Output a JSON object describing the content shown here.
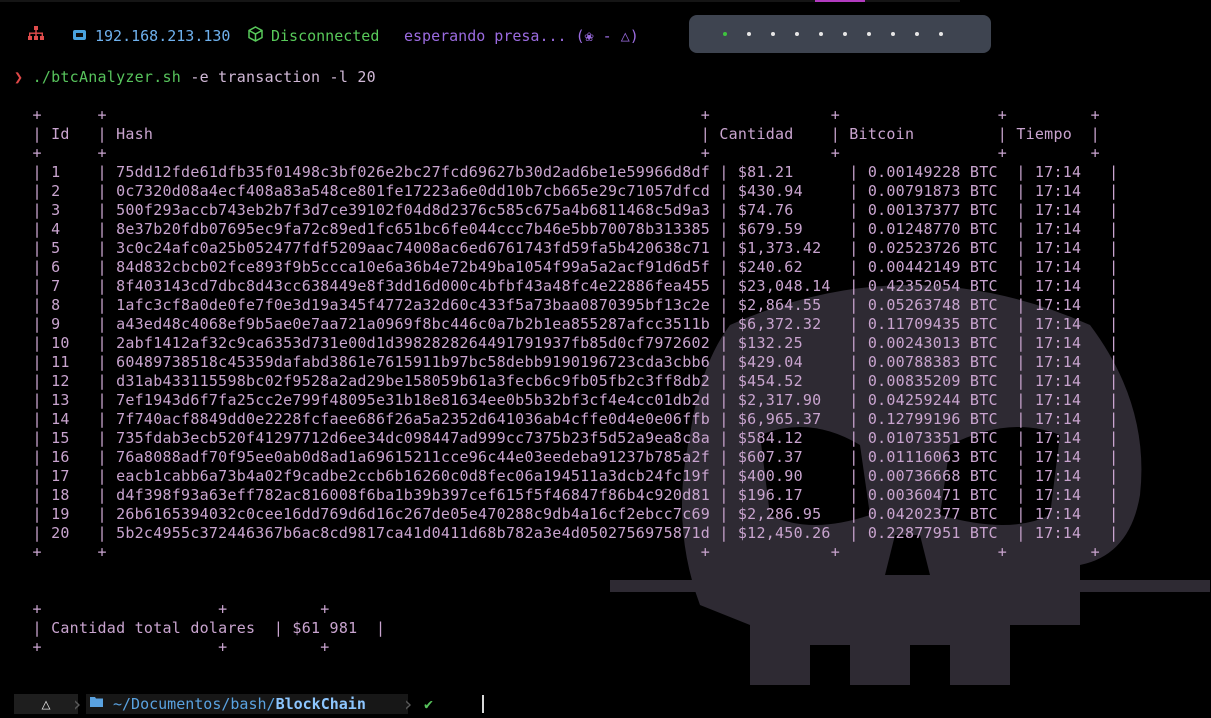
{
  "topbar": {
    "network_icon": "network-icon",
    "ip_icon": "monitor-icon",
    "ip": "192.168.213.130",
    "vpn_icon": "cube-icon",
    "vpn_status": "Disconnected",
    "status_text": "esperando presa... (",
    "status_icons": "❀ - △",
    "status_end": ")",
    "workspaces": 10,
    "active_workspace": 1,
    "accent_color": "#b23bbf"
  },
  "command": {
    "prompt": "❯",
    "program": "./btcAnalyzer.sh",
    "args": " -e transaction -l 20"
  },
  "table": {
    "border_line": "  +      +                                                                +             +                 +         +",
    "header_line": "  | Id   | Hash                                                           | Cantidad    | Bitcoin         | Tiempo  |",
    "rows": [
      "  | 1    | 75dd12fde61dfb35f01498c3bf026e2bc27fcd69627b30d2ad6be1e59966d8df | $81.21      | 0.00149228 BTC  | 17:14   |",
      "  | 2    | 0c7320d08a4ecf408a83a548ce801fe17223a6e0dd10b7cb665e29c71057dfcd | $430.94     | 0.00791873 BTC  | 17:14   |",
      "  | 3    | 500f293accb743eb2b7f3d7ce39102f04d8d2376c585c675a4b6811468c5d9a3 | $74.76      | 0.00137377 BTC  | 17:14   |",
      "  | 4    | 8e37b20fdb07695ec9fa72c89ed1fc651bc6fe044ccc7b46e5bb70078b313385 | $679.59     | 0.01248770 BTC  | 17:14   |",
      "  | 5    | 3c0c24afc0a25b052477fdf5209aac74008ac6ed6761743fd59fa5b420638c71 | $1,373.42   | 0.02523726 BTC  | 17:14   |",
      "  | 6    | 84d832cbcb02fce893f9b5ccca10e6a36b4e72b49ba1054f99a5a2acf91d6d5f | $240.62     | 0.00442149 BTC  | 17:14   |",
      "  | 7    | 8f403143cd7dbc8d43cc638449e8f3dd16d000c4bfbf43a48fc4e22886fea455 | $23,048.14  | 0.42352054 BTC  | 17:14   |",
      "  | 8    | 1afc3cf8a0de0fe7f0e3d19a345f4772a32d60c433f5a73baa0870395bf13c2e | $2,864.55   | 0.05263748 BTC  | 17:14   |",
      "  | 9    | a43ed48c4068ef9b5ae0e7aa721a0969f8bc446c0a7b2b1ea855287afcc3511b | $6,372.32   | 0.11709435 BTC  | 17:14   |",
      "  | 10   | 2abf1412af32c9ca6353d731e00d1d398282826449179193 7fb85d0cf7972602 | $132.25     | 0.00243013 BTC  | 17:14   |",
      "  | 11   | 60489738518c45359dafabd3861e7615911b97bc58debb9190196723cda3cbb6 | $429.04     | 0.00788383 BTC  | 17:14   |",
      "  | 12   | d31ab433115598bc02f9528a2ad29be158059b61a3fecb6c9fb05fb2c3ff8db2 | $454.52     | 0.00835209 BTC  | 17:14   |",
      "  | 13   | 7ef1943d6f7fa25cc2e799f48095e31b18e81634ee0b5b32bf3cf4e4cc01db2d | $2,317.90   | 0.04259244 BTC  | 17:14   |",
      "  | 14   | 7f740acf8849dd0e2228fcfaee686f26a5a2352d641036ab4cffe0d4e0e06ffb | $6,965.37   | 0.12799196 BTC  | 17:14   |",
      "  | 15   | 735fdab3ecb520f41297712d6ee34dc098447ad999cc7375b23f5d52a9ea8c8a | $584.12     | 0.01073351 BTC  | 17:14   |",
      "  | 16   | 76a8088adf70f95ee0ab0d8ad1a69615211cce96c44e03eedeba91237b785a2f | $607.37     | 0.01116063 BTC  | 17:14   |",
      "  | 17   | eacb1cabb6a73b4a02f9cadbe2ccb6b16260c0d8fec06a194511a3dcb24fc19f | $400.90     | 0.00736668 BTC  | 17:14   |",
      "  | 18   | d4f398f93a63eff782ac816008f6ba1b39b397cef615f5f46847f86b4c920d81 | $196.17     | 0.00360471 BTC  | 17:14   |",
      "  | 19   | 26b6165394032c0cee16dd769d6d16c267de05e470288c9db4a16cf2ebcc7c69 | $2,286.95   | 0.04202377 BTC  | 17:14   |",
      "  | 20   | 5b2c4955c372446367b6ac8cd9817ca41d0411d68b782a3e4d0502756975871d | $12,450.26  | 0.22877951 BTC  | 17:14   |"
    ]
  },
  "total_table": {
    "border_line": "  +                   +          +",
    "row_line": "  | Cantidad total dolares  | $61 981  |"
  },
  "statusbar": {
    "os_icon": "linux-icon",
    "os_glyph": "△",
    "folder_icon": "folder-icon",
    "path_prefix": "~/Documentos/bash/",
    "path_last": "BlockChain",
    "check": "✔"
  }
}
